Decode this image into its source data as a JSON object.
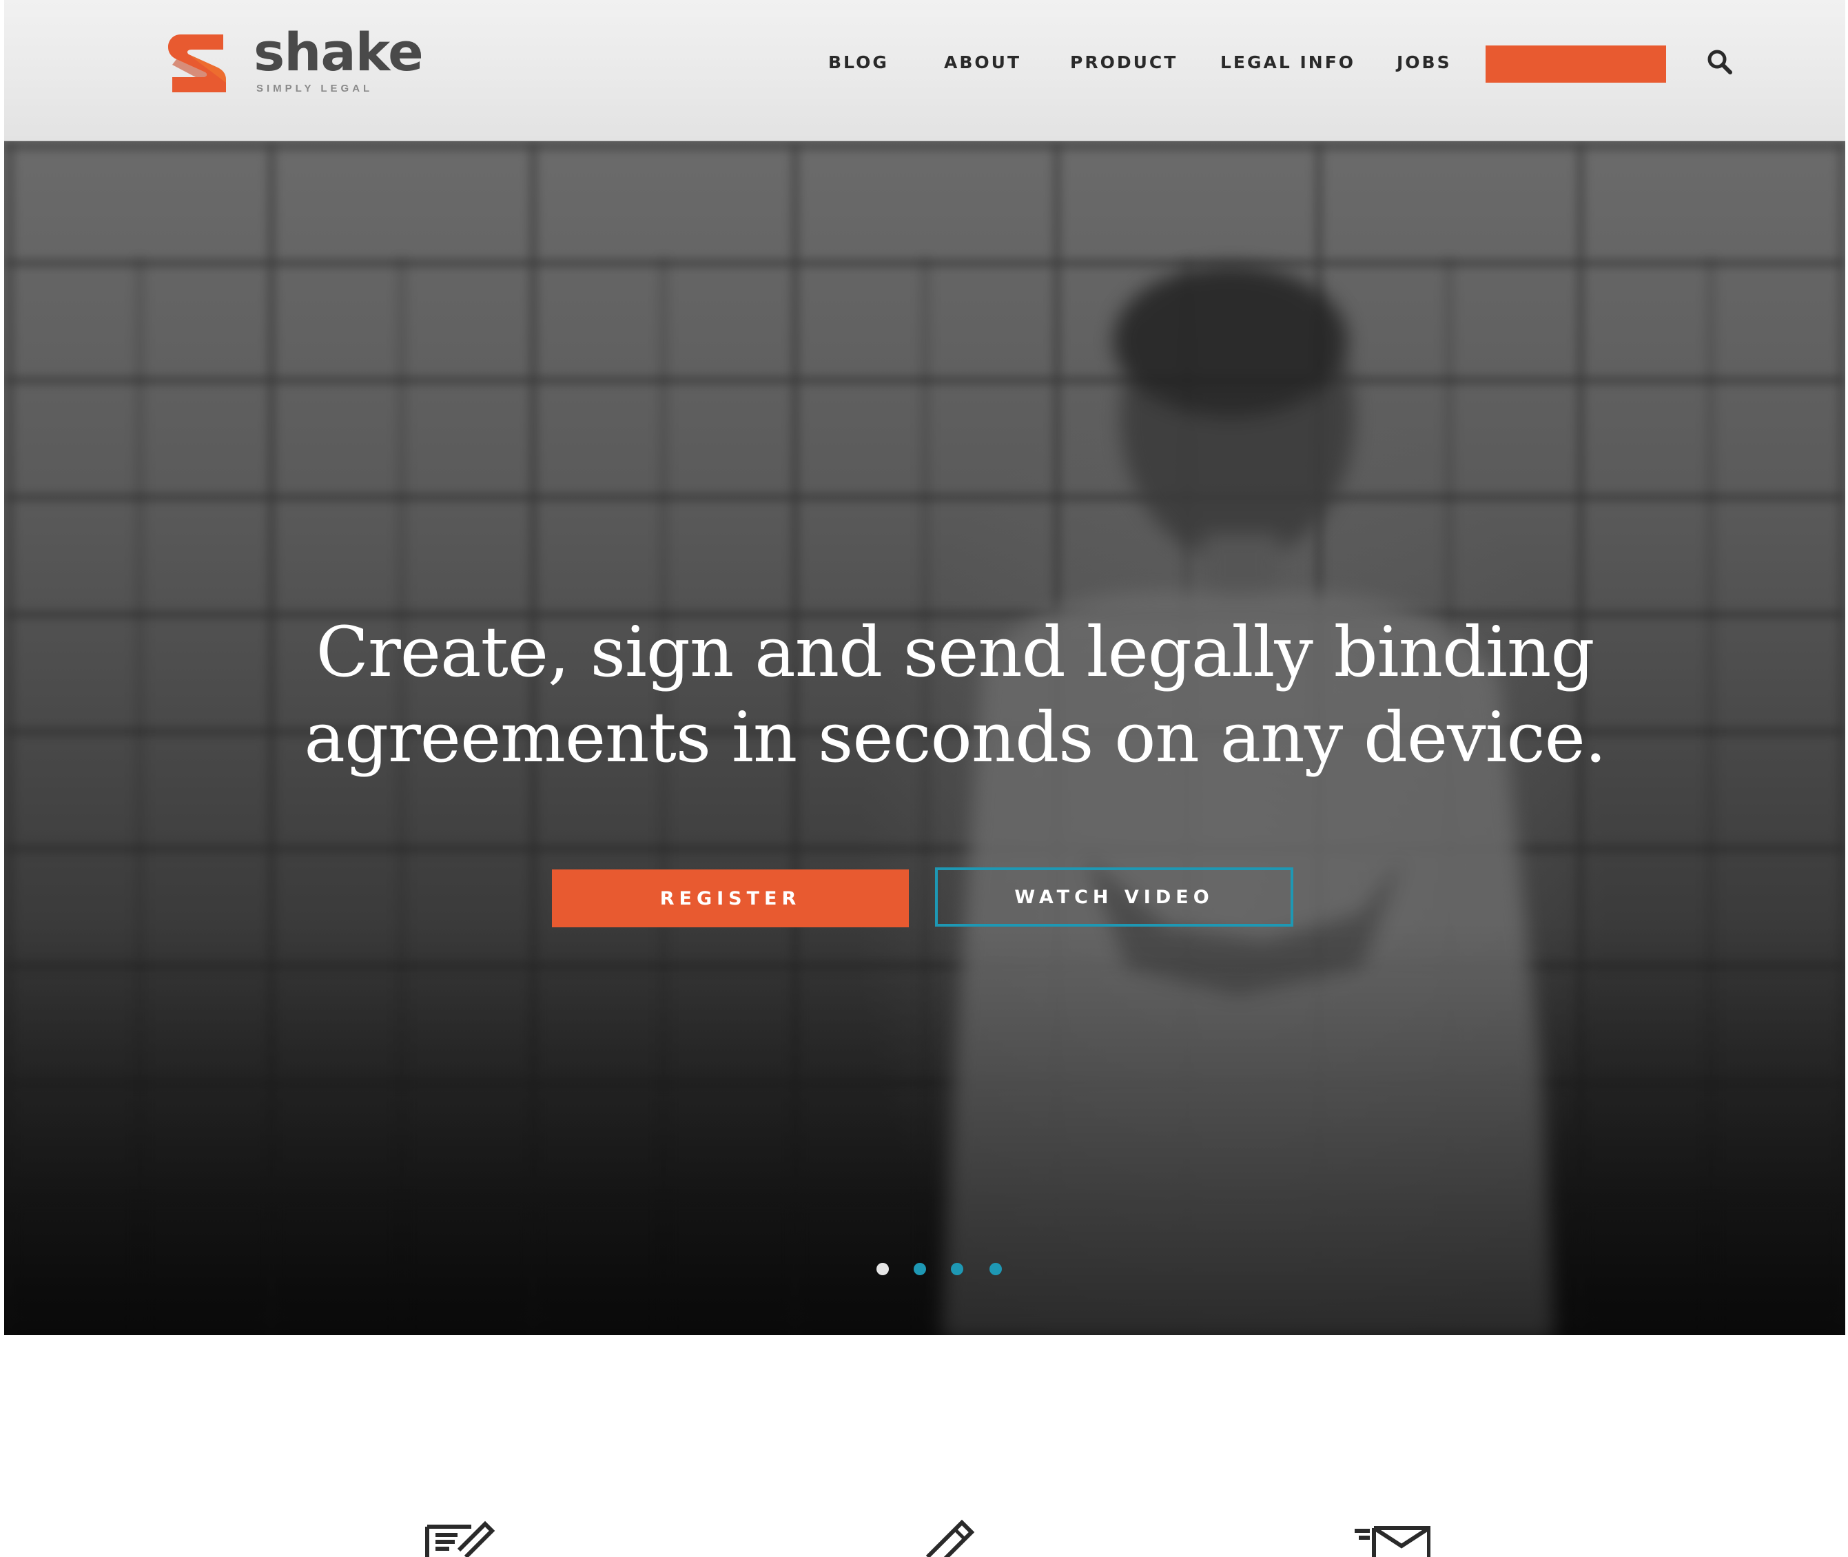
{
  "brand": {
    "name": "shake",
    "tagline": "SIMPLY LEGAL",
    "accent": "#e85a30",
    "secondary": "#1e98b4"
  },
  "nav": {
    "items": [
      "BLOG",
      "ABOUT",
      "PRODUCT",
      "LEGAL INFO",
      "JOBS"
    ],
    "cta_label": "",
    "search_icon": "search-icon"
  },
  "hero": {
    "headline_line1": "Create, sign and send legally binding",
    "headline_line2": "agreements in seconds on any device.",
    "primary_button": "REGISTER",
    "secondary_button": "WATCH VIDEO",
    "carousel": {
      "slides": 4,
      "active_index": 0,
      "active_color": "#e6e6e6",
      "inactive_color": "#1e98b4"
    }
  },
  "features": {
    "icons": [
      "document-edit-icon",
      "pencil-icon",
      "send-mail-icon"
    ]
  }
}
